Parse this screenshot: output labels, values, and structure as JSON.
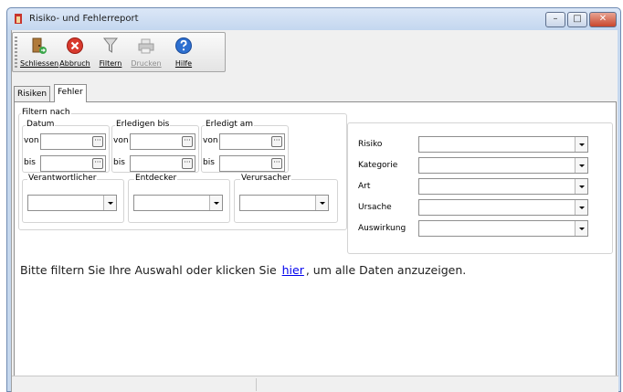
{
  "window": {
    "title": "Risiko- und Fehlerreport",
    "controls": {
      "minimize": "–",
      "maximize": "□",
      "close": "✕"
    }
  },
  "toolbar": {
    "buttons": [
      {
        "label": "Schliessen",
        "icon": "door-exit-icon",
        "enabled": true
      },
      {
        "label": "Abbruch",
        "icon": "cancel-x-icon",
        "enabled": true
      },
      {
        "label": "Filtern",
        "icon": "funnel-filter-icon",
        "enabled": true
      },
      {
        "label": "Drucken",
        "icon": "printer-icon",
        "enabled": false
      },
      {
        "label": "Hilfe",
        "icon": "help-question-icon",
        "enabled": true
      }
    ]
  },
  "tabs": [
    {
      "label": "Risiken",
      "active": false
    },
    {
      "label": "Fehler",
      "active": true
    }
  ],
  "filter": {
    "group_title": "Filtern nach",
    "date_groups": [
      {
        "title": "Datum",
        "from_label": "von",
        "to_label": "bis",
        "from_value": "",
        "to_value": ""
      },
      {
        "title": "Erledigen bis",
        "from_label": "von",
        "to_label": "bis",
        "from_value": "",
        "to_value": ""
      },
      {
        "title": "Erledigt am",
        "from_label": "von",
        "to_label": "bis",
        "from_value": "",
        "to_value": ""
      }
    ],
    "date_button": "···",
    "person_groups": [
      {
        "title": "Verantwortlicher",
        "value": ""
      },
      {
        "title": "Entdecker",
        "value": ""
      },
      {
        "title": "Verursacher",
        "value": ""
      }
    ],
    "right_fields": [
      {
        "label": "Risiko",
        "value": ""
      },
      {
        "label": "Kategorie",
        "value": ""
      },
      {
        "label": "Art",
        "value": ""
      },
      {
        "label": "Ursache",
        "value": ""
      },
      {
        "label": "Auswirkung",
        "value": ""
      }
    ]
  },
  "message": {
    "before": "Bitte filtern Sie Ihre Auswahl oder klicken Sie",
    "link": "hier",
    "after": ", um alle Daten anzuzeigen."
  },
  "colors": {
    "titlebar": "#c4d7ef",
    "close_button": "#c9462c",
    "link": "#0000ee",
    "cancel_icon": "#d83a2e",
    "help_icon": "#2d6fd0"
  }
}
